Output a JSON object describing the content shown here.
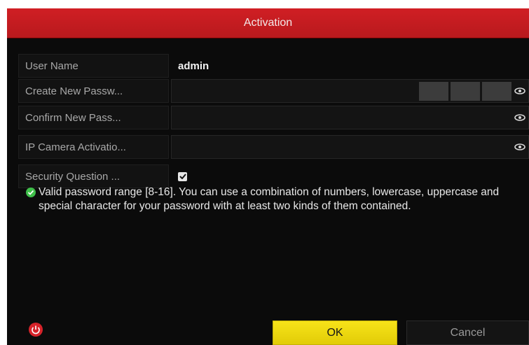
{
  "dialog": {
    "title": "Activation"
  },
  "fields": {
    "user_name": {
      "label": "User Name",
      "value": "admin"
    },
    "create_password": {
      "label": "Create New Passw...",
      "value": ""
    },
    "confirm_password": {
      "label": "Confirm New Pass...",
      "value": ""
    },
    "ip_camera_activation": {
      "label": "IP Camera Activatio...",
      "value": ""
    },
    "security_question": {
      "label": "Security Question ...",
      "checked": true
    }
  },
  "password_strength": {
    "segments": 3,
    "filled": 0
  },
  "hint": {
    "text": "Valid password range [8-16]. You can use a combination of numbers, lowercase, uppercase and special character for your password with at least two kinds of them contained."
  },
  "buttons": {
    "ok_label": "OK",
    "cancel_label": "Cancel"
  },
  "colors": {
    "title_bar": "#c81d22",
    "ok_button": "#f0dd12",
    "check_icon": "#3fbf4a",
    "power_icon": "#d6232a"
  },
  "icons": {
    "show_password": "eye-icon",
    "hint": "check-circle-icon",
    "power": "power-icon"
  }
}
